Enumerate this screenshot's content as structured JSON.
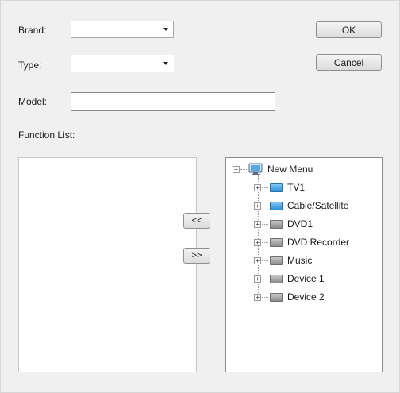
{
  "form": {
    "brand_label": "Brand:",
    "type_label": "Type:",
    "model_label": "Model:",
    "function_list_label": "Function List:",
    "brand_value": "",
    "type_value": "",
    "model_value": ""
  },
  "buttons": {
    "ok": "OK",
    "cancel": "Cancel",
    "move_left": "<<",
    "move_right": ">>"
  },
  "tree": {
    "root": {
      "label": "New Menu",
      "icon": "monitor-icon"
    },
    "items": [
      {
        "label": "TV1",
        "icon": "device-icon",
        "color": "#3a9ee0"
      },
      {
        "label": "Cable/Satellite",
        "icon": "device-icon",
        "color": "#3a9ee0"
      },
      {
        "label": "DVD1",
        "icon": "device-icon",
        "color": "#8c8c8c"
      },
      {
        "label": "DVD Recorder",
        "icon": "device-icon",
        "color": "#8c8c8c"
      },
      {
        "label": "Music",
        "icon": "device-icon",
        "color": "#8c8c8c"
      },
      {
        "label": "Device 1",
        "icon": "device-icon",
        "color": "#8c8c8c"
      },
      {
        "label": "Device 2",
        "icon": "device-icon",
        "color": "#8c8c8c"
      }
    ]
  }
}
